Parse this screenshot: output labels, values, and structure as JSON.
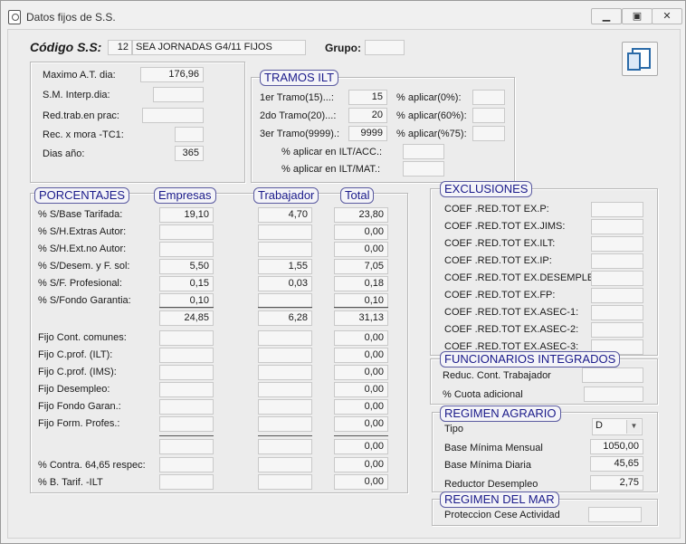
{
  "window": {
    "title": "Datos fijos de S.S."
  },
  "header": {
    "codigo_label": "Código S.S:",
    "codigo_num": "12",
    "codigo_desc": "SEA JORNADAS G4/11 FIJOS",
    "grupo_label": "Grupo:",
    "grupo_value": ""
  },
  "general": {
    "maximo_label": "Maximo A.T. dia:",
    "maximo_value": "176,96",
    "sm_label": "S.M. Interp.dia:",
    "sm_value": "",
    "red_label": "Red.trab.en prac:",
    "red_value": "",
    "rec_label": "Rec. x mora -TC1:",
    "rec_value": "",
    "dias_label": "Dias año:",
    "dias_value": "365"
  },
  "tramos": {
    "title": "TRAMOS ILT",
    "t1_label": "1er Tramo(15)...:",
    "t1_value": "15",
    "p1_label": "% aplicar(0%):",
    "p1_value": "",
    "t2_label": "2do Tramo(20)...:",
    "t2_value": "20",
    "p2_label": "% aplicar(60%):",
    "p2_value": "",
    "t3_label": "3er Tramo(9999).:",
    "t3_value": "9999",
    "p3_label": "% aplicar(%75):",
    "p3_value": "",
    "acc_label": "% aplicar en ILT/ACC.:",
    "acc_value": "",
    "mat_label": "% aplicar en ILT/MAT.:",
    "mat_value": ""
  },
  "porcentajes": {
    "title": "PORCENTAJES",
    "col_empresas": "Empresas",
    "col_trabajador": "Trabajador",
    "col_total": "Total",
    "rows": [
      {
        "label": "% S/Base Tarifada:",
        "emp": "19,10",
        "trab": "4,70",
        "total": "23,80"
      },
      {
        "label": "% S/H.Extras Autor:",
        "emp": "",
        "trab": "",
        "total": "0,00"
      },
      {
        "label": "% S/H.Ext.no Autor:",
        "emp": "",
        "trab": "",
        "total": "0,00"
      },
      {
        "label": "% S/Desem. y F. sol:",
        "emp": "5,50",
        "trab": "1,55",
        "total": "7,05"
      },
      {
        "label": "% S/F. Profesional:",
        "emp": "0,15",
        "trab": "0,03",
        "total": "0,18"
      },
      {
        "label": "% S/Fondo Garantia:",
        "emp": "0,10",
        "trab": "",
        "total": "0,10"
      }
    ],
    "sum": {
      "emp": "24,85",
      "trab": "6,28",
      "total": "31,13"
    },
    "fijos": [
      {
        "label": "Fijo Cont. comunes:",
        "emp": "",
        "trab": "",
        "total": "0,00"
      },
      {
        "label": "Fijo   C.prof. (ILT):",
        "emp": "",
        "trab": "",
        "total": "0,00"
      },
      {
        "label": "Fijo  C.prof. (IMS):",
        "emp": "",
        "trab": "",
        "total": "0,00"
      },
      {
        "label": "Fijo  Desempleo:",
        "emp": "",
        "trab": "",
        "total": "0,00"
      },
      {
        "label": "Fijo  Fondo Garan.:",
        "emp": "",
        "trab": "",
        "total": "0,00"
      },
      {
        "label": "Fijo Form. Profes.:",
        "emp": "",
        "trab": "",
        "total": "0,00"
      }
    ],
    "fijos_sum": {
      "emp": "",
      "trab": "",
      "total": "0,00"
    },
    "contra_label": "% Contra. 64,65 respec:",
    "contra_emp": "",
    "contra_trab": "",
    "contra_total": "0,00",
    "btarif_label": "% B. Tarif. -ILT",
    "btarif_emp": "",
    "btarif_trab": "",
    "btarif_total": "0,00"
  },
  "exclusiones": {
    "title": "EXCLUSIONES",
    "items": [
      {
        "label": "COEF .RED.TOT EX.P:",
        "value": ""
      },
      {
        "label": "COEF .RED.TOT EX.JIMS:",
        "value": ""
      },
      {
        "label": "COEF .RED.TOT EX.ILT:",
        "value": ""
      },
      {
        "label": "COEF .RED.TOT EX.IP:",
        "value": ""
      },
      {
        "label": "COEF .RED.TOT EX.DESEMPLEO:",
        "value": ""
      },
      {
        "label": "COEF .RED.TOT EX.FP:",
        "value": ""
      },
      {
        "label": "COEF .RED.TOT EX.ASEC-1:",
        "value": ""
      },
      {
        "label": "COEF .RED.TOT EX.ASEC-2:",
        "value": ""
      },
      {
        "label": "COEF .RED.TOT EX.ASEC-3:",
        "value": ""
      }
    ]
  },
  "funcionarios": {
    "title": "FUNCIONARIOS INTEGRADOS",
    "reduc_label": "Reduc. Cont. Trabajador",
    "reduc_value": "",
    "cuota_label": "% Cuota adicional",
    "cuota_value": ""
  },
  "agrario": {
    "title": "REGIMEN AGRARIO",
    "tipo_label": "Tipo",
    "tipo_value": "D",
    "bmm_label": "Base Mínima Mensual",
    "bmm_value": "1050,00",
    "bmd_label": "Base Mínima Diaria",
    "bmd_value": "45,65",
    "red_label": "Reductor Desempleo",
    "red_value": "2,75"
  },
  "mar": {
    "title": "REGIMEN DEL MAR",
    "prot_label": "Proteccion Cese Actividad",
    "prot_value": ""
  },
  "icons": {
    "title_icon": "app-icon",
    "minimize": "minimize-icon",
    "maximize": "maximize-icon",
    "close": "close-icon",
    "copy": "copy-icon"
  }
}
